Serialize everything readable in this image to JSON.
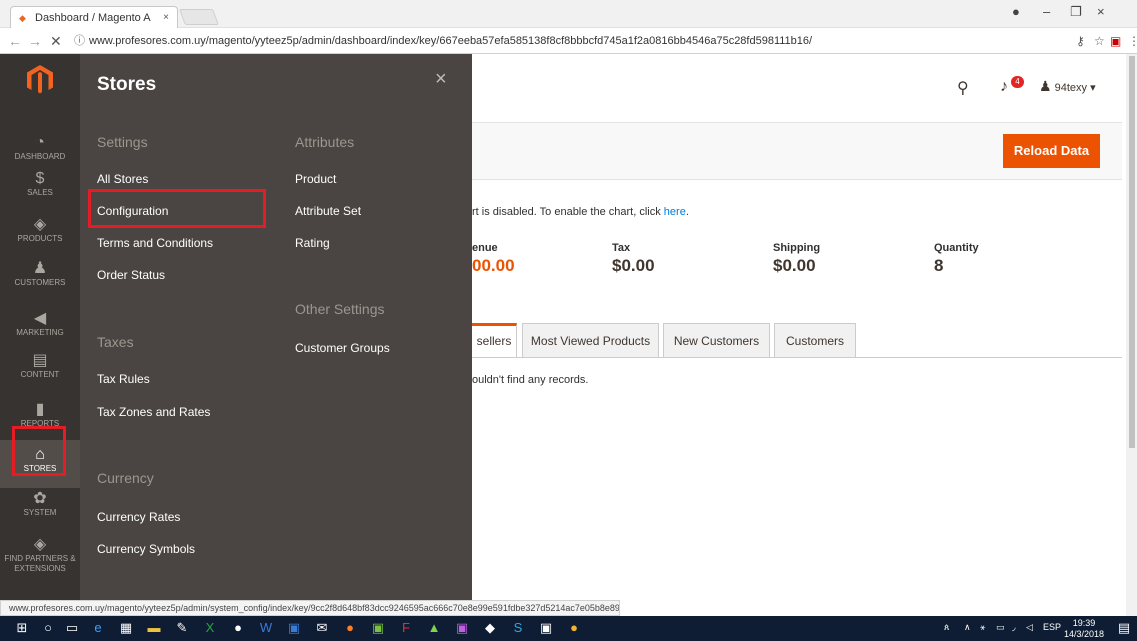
{
  "browser": {
    "tab_title": "Dashboard / Magento A",
    "tab_close": "×",
    "url_info_icon": "ⓘ",
    "url": "www.profesores.com.uy/magento/yyteez5p/admin/dashboard/index/key/667eeba57efa585138f8cf8bbbcfd745a1f2a0816bb4546a75c28fd598111b16/",
    "status_url": "www.profesores.com.uy/magento/yyteez5p/admin/system_config/index/key/9cc2f8d648bf83dcc9246595ac666c70e8e99e591fdbe327d5214ac7e05b8e89/"
  },
  "sidebar": {
    "items": [
      {
        "icon": "dashboard-icon",
        "glyph": "◔",
        "label": "DASHBOARD"
      },
      {
        "icon": "dollar-icon",
        "glyph": "$",
        "label": "SALES"
      },
      {
        "icon": "box-icon",
        "glyph": "◈",
        "label": "PRODUCTS"
      },
      {
        "icon": "person-icon",
        "glyph": "♟",
        "label": "CUSTOMERS"
      },
      {
        "icon": "megaphone-icon",
        "glyph": "◀",
        "label": "MARKETING"
      },
      {
        "icon": "content-icon",
        "glyph": "▤",
        "label": "CONTENT"
      },
      {
        "icon": "bar-chart-icon",
        "glyph": "▮",
        "label": "REPORTS"
      },
      {
        "icon": "store-icon",
        "glyph": "⌂",
        "label": "STORES"
      },
      {
        "icon": "gear-icon",
        "glyph": "✿",
        "label": "SYSTEM"
      },
      {
        "icon": "puzzle-icon",
        "glyph": "◈",
        "label": "FIND PARTNERS & EXTENSIONS"
      }
    ]
  },
  "stores_menu": {
    "title": "Stores",
    "close": "×",
    "settings": {
      "title": "Settings",
      "links": [
        "All Stores",
        "Configuration",
        "Terms and Conditions",
        "Order Status"
      ]
    },
    "taxes": {
      "title": "Taxes",
      "links": [
        "Tax Rules",
        "Tax Zones and Rates"
      ]
    },
    "currency": {
      "title": "Currency",
      "links": [
        "Currency Rates",
        "Currency Symbols"
      ]
    },
    "attributes": {
      "title": "Attributes",
      "links": [
        "Product",
        "Attribute Set",
        "Rating"
      ]
    },
    "other_settings": {
      "title": "Other Settings",
      "links": [
        "Customer Groups"
      ]
    }
  },
  "header": {
    "notifications_count": "4",
    "username": "94texy ▾"
  },
  "actions": {
    "reload_label": "Reload Data"
  },
  "dashboard": {
    "chart_msg": "rt is disabled. To enable the chart, click ",
    "chart_link": "here",
    "chart_msg_end": ".",
    "stats": [
      {
        "label": "enue",
        "value": "00.00"
      },
      {
        "label": "Tax",
        "value": "$0.00"
      },
      {
        "label": "Shipping",
        "value": "$0.00"
      },
      {
        "label": "Quantity",
        "value": "8"
      }
    ],
    "tabs": [
      "sellers",
      "Most Viewed Products",
      "New Customers",
      "Customers"
    ],
    "no_records": "ouldn't find any records."
  },
  "taskbar": {
    "lang": "ESP",
    "time": "19:39",
    "date": "14/3/2018",
    "notif_count": "2"
  },
  "colors": {
    "accent": "#eb5202",
    "highlight_box": "#e51c23",
    "menu_bg": "#373330",
    "submenu_bg": "#4a4542"
  }
}
